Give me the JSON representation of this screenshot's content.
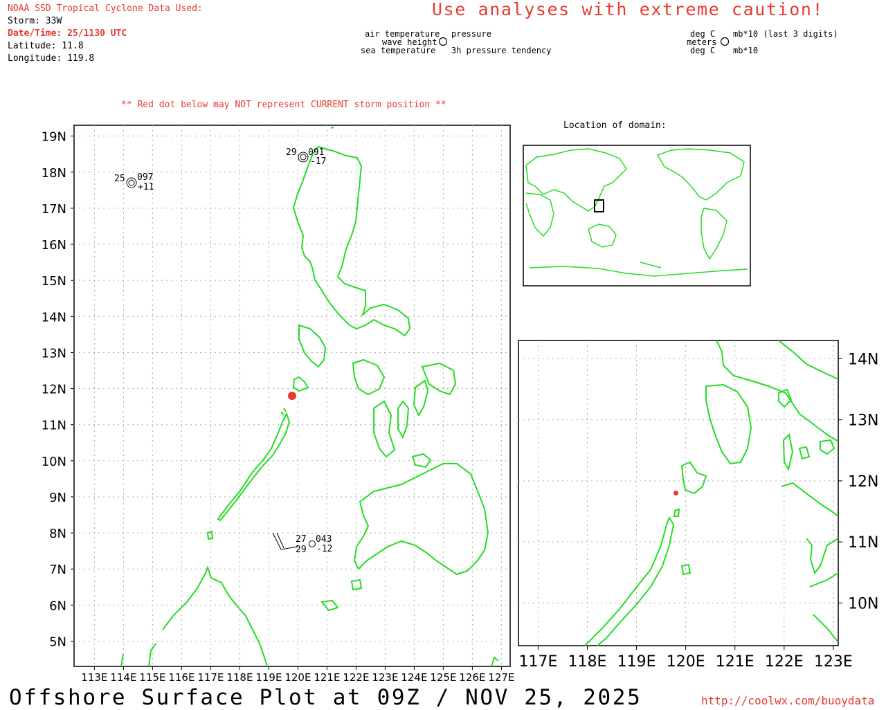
{
  "header": {
    "source_line": "NOAA SSD Tropical Cyclone Data Used:",
    "storm": "Storm: 33W",
    "datetime": "Date/Time: 25/1130 UTC",
    "latitude": "Latitude: 11.8",
    "longitude": "Longitude: 119.8",
    "caution": "Use analyses with extreme caution!"
  },
  "legend": {
    "air_temperature": "air temperature",
    "wave_height": "wave height",
    "sea_temperature": "sea temperature",
    "pressure": "pressure",
    "pressure_tendency": "3h pressure tendency",
    "unit_degc_top": "deg C",
    "unit_meters": "meters",
    "unit_degc_bottom": "deg C",
    "unit_mb_top": "mb*10 (last 3 digits)",
    "unit_mb_bottom": "mb*10"
  },
  "warning": "** Red dot below may NOT represent CURRENT storm position **",
  "inset_title": "Location of domain:",
  "main_map": {
    "lat_labels": [
      "19N",
      "18N",
      "17N",
      "16N",
      "15N",
      "14N",
      "13N",
      "12N",
      "11N",
      "10N",
      "9N",
      "8N",
      "7N",
      "6N",
      "5N"
    ],
    "lon_labels": [
      "113E",
      "114E",
      "115E",
      "116E",
      "117E",
      "118E",
      "119E",
      "120E",
      "121E",
      "122E",
      "123E",
      "124E",
      "125E",
      "126E",
      "127E"
    ],
    "observations": [
      {
        "air": "29",
        "pressure": "091",
        "tendency": "-17",
        "sea": ""
      },
      {
        "air": "25",
        "pressure": "097",
        "tendency": "+11",
        "sea": ""
      },
      {
        "air": "27",
        "pressure": "043",
        "tendency": "-12",
        "sea": "29"
      }
    ],
    "storm_position": {
      "lat": 11.8,
      "lon": 119.8
    }
  },
  "zoom_map": {
    "lat_labels": [
      "14N",
      "13N",
      "12N",
      "11N",
      "10N"
    ],
    "lon_labels": [
      "117E",
      "118E",
      "119E",
      "120E",
      "121E",
      "122E",
      "123E"
    ]
  },
  "colors": {
    "coast": "#22dd22",
    "storm_dot": "#e8392f",
    "caution": "#e8392f"
  },
  "footer": {
    "title": "Offshore Surface Plot at 09Z / NOV 25, 2025",
    "url": "http://coolwx.com/buoydata"
  }
}
